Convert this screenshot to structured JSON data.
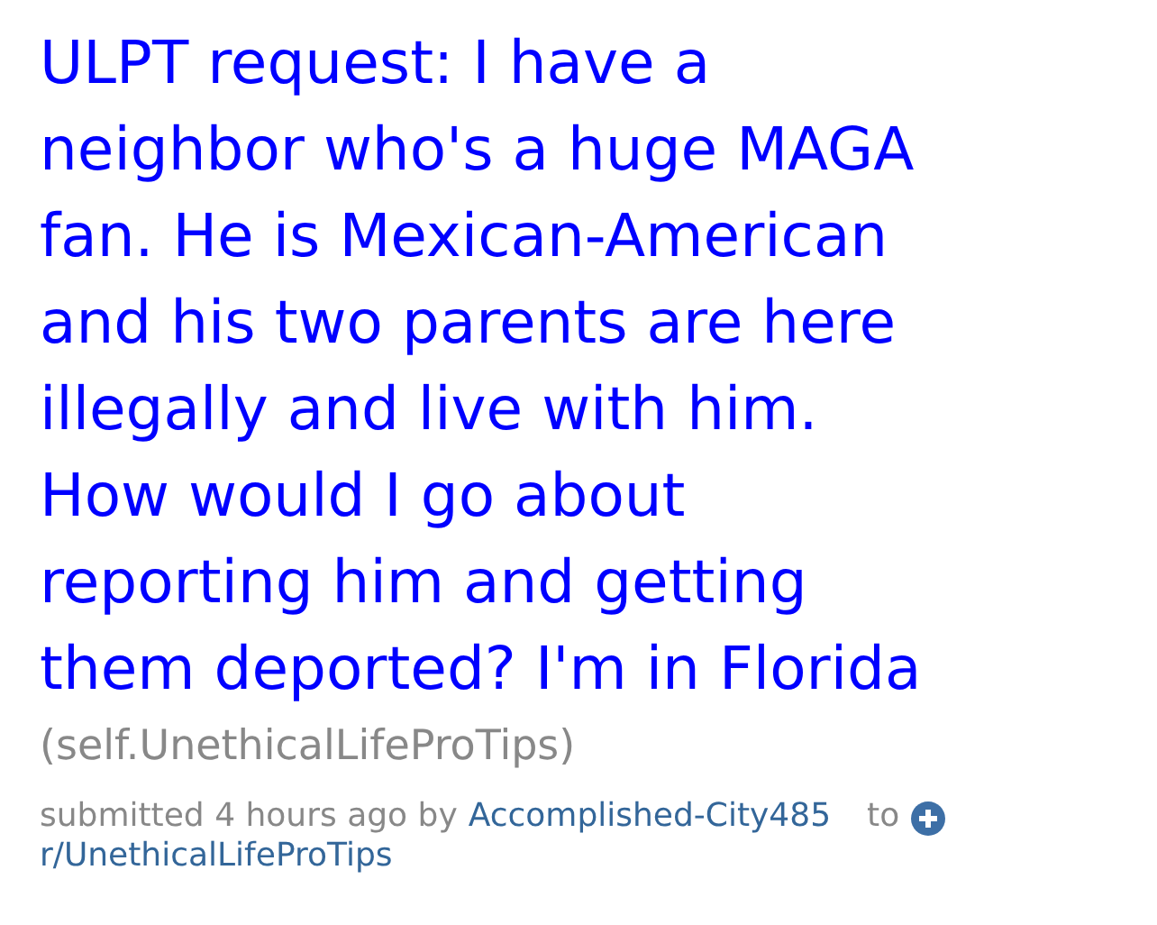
{
  "post": {
    "title": "ULPT request: I have a\nneighbor who's a huge MAGA\nfan. He is Mexican-American\nand his two parents are here\nillegally and live with him.\nHow would I go about\nreporting him and getting\nthem deported? I'm in Florida",
    "domain": "(self.UnethicalLifeProTips)",
    "tagline": {
      "prefix": "submitted 4 hours ago by",
      "author": "Accomplished-City485",
      "to": "to",
      "subreddit": "r/UnethicalLifeProTips"
    }
  }
}
